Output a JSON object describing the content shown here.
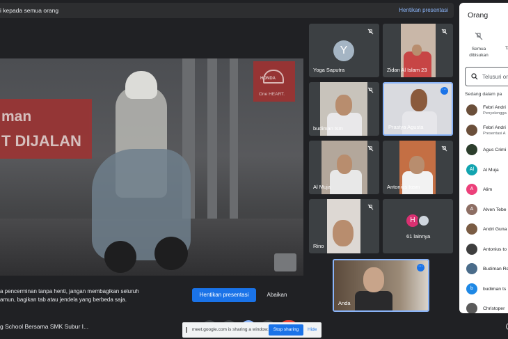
{
  "topbar": {
    "message": "i kepada semua orang",
    "stop_link": "Hentikan presentasi"
  },
  "presentation": {
    "banner_line1": "man",
    "banner_line2": "T DIJALAN",
    "honda_brand": "HONDA",
    "honda_slogan": "One HEART.",
    "warning_text": "a pencerminan tanpa henti, jangan membagikan seluruh\namun, bagikan tab atau jendela yang berbeda saja.",
    "stop_button": "Hentikan presentasi",
    "ignore_button": "Abaikan"
  },
  "tiles": [
    {
      "name": "Yoga Saputra",
      "avatar_letter": "Y",
      "muted": true
    },
    {
      "name": "Zidan Al Islam 23",
      "muted": true
    },
    {
      "name": "budiman tsm",
      "muted": true
    },
    {
      "name": "Prastya Agusta",
      "muted": false
    },
    {
      "name": "Al Muja",
      "muted": true
    },
    {
      "name": "Antonius tosm",
      "muted": true
    },
    {
      "name": "Rino",
      "muted": true
    },
    {
      "name": "61 lainnya",
      "avatar_letter": "H"
    },
    {
      "name": "Anda"
    }
  ],
  "bottombar": {
    "meeting_title": "g School Bersama SMK Subur I...",
    "sharing_text": "meet.google.com is sharing a window.",
    "stop_sharing": "Stop sharing",
    "hide": "Hide"
  },
  "panel": {
    "title": "Orang",
    "mute_all": "Semua\ndibisukan",
    "tab2": "Ta",
    "search_placeholder": "Telusuri ora",
    "section_label": "Sedang dalam pa",
    "people": [
      {
        "name": "Febri Andri",
        "role": "Penyelengga",
        "avatar_color": "#6b4f3a"
      },
      {
        "name": "Febri Andri",
        "role": "Presentasi A",
        "avatar_color": "#6b4f3a"
      },
      {
        "name": "Agus Crimi",
        "role": "",
        "avatar_color": "#2c3e2c"
      },
      {
        "name": "Al Muja",
        "role": "",
        "avatar_color": "#12a4af",
        "letter": "Al"
      },
      {
        "name": "Alim",
        "role": "",
        "avatar_color": "#ec407a",
        "letter": "A"
      },
      {
        "name": "Alven Tebe",
        "role": "",
        "avatar_color": "#8d6e63",
        "letter": "A"
      },
      {
        "name": "Andri Guna",
        "role": "",
        "avatar_color": "#7a5c44"
      },
      {
        "name": "Antonius to",
        "role": "",
        "avatar_color": "#3e3e3e"
      },
      {
        "name": "Budiman Re",
        "role": "",
        "avatar_color": "#4a6c8a"
      },
      {
        "name": "budiman ts",
        "role": "",
        "avatar_color": "#1e88e5",
        "letter": "b"
      },
      {
        "name": "Christoper",
        "role": "",
        "avatar_color": "#5a5a5a"
      }
    ]
  }
}
